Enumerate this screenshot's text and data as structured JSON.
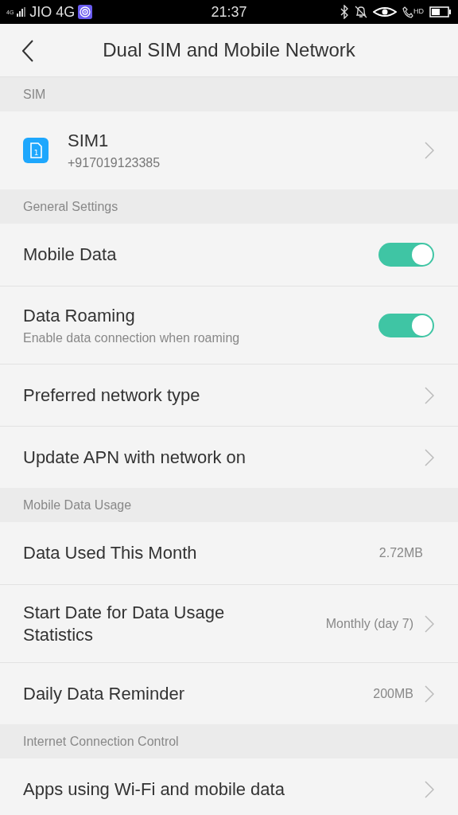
{
  "status_bar": {
    "network_badge": "4G",
    "carrier": "JIO 4G",
    "time": "21:37",
    "call_badge": "HD"
  },
  "header": {
    "title": "Dual SIM and Mobile Network"
  },
  "sections": [
    {
      "title": "SIM",
      "rows": [
        {
          "kind": "sim",
          "label": "SIM1",
          "subtitle": "+917019123385",
          "sim_number": "1"
        }
      ]
    },
    {
      "title": "General Settings",
      "rows": [
        {
          "kind": "toggle",
          "label": "Mobile Data",
          "on": true
        },
        {
          "kind": "toggle",
          "label": "Data Roaming",
          "subtitle": "Enable data connection when roaming",
          "on": true
        },
        {
          "kind": "nav",
          "label": "Preferred network type"
        },
        {
          "kind": "nav",
          "label": "Update APN with network on"
        }
      ]
    },
    {
      "title": "Mobile Data Usage",
      "rows": [
        {
          "kind": "value",
          "label": "Data Used This Month",
          "value": "2.72MB"
        },
        {
          "kind": "nav",
          "label": "Start Date for Data Usage Statistics",
          "value": "Monthly (day 7)"
        },
        {
          "kind": "nav",
          "label": "Daily Data Reminder",
          "value": "200MB"
        }
      ]
    },
    {
      "title": "Internet Connection Control",
      "rows": [
        {
          "kind": "nav",
          "label": "Apps using Wi-Fi and mobile data"
        }
      ]
    }
  ]
}
